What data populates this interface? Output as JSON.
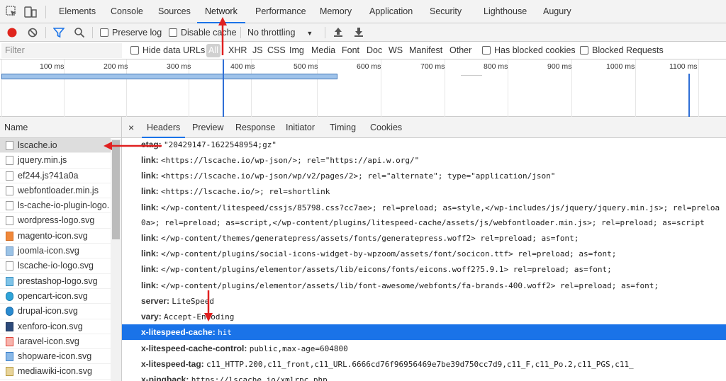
{
  "tabs": [
    "Elements",
    "Console",
    "Sources",
    "Network",
    "Performance",
    "Memory",
    "Application",
    "Security",
    "Lighthouse",
    "Augury"
  ],
  "active_tab": "Network",
  "toolbar": {
    "preserve_log": "Preserve log",
    "disable_cache": "Disable cache",
    "throttling": "No throttling"
  },
  "filter": {
    "placeholder": "Filter",
    "hide_data_urls": "Hide data URLs",
    "types": [
      "All",
      "XHR",
      "JS",
      "CSS",
      "Img",
      "Media",
      "Font",
      "Doc",
      "WS",
      "Manifest",
      "Other"
    ],
    "has_blocked_cookies": "Has blocked cookies",
    "blocked_requests": "Blocked Requests"
  },
  "timeline": {
    "ticks": [
      "100 ms",
      "200 ms",
      "300 ms",
      "400 ms",
      "500 ms",
      "600 ms",
      "700 ms",
      "800 ms",
      "900 ms",
      "1000 ms",
      "1100 ms"
    ]
  },
  "name_column": {
    "header": "Name",
    "files": [
      "lscache.io",
      "jquery.min.js",
      "ef244.js?41a0a",
      "webfontloader.min.js",
      "ls-cache-io-plugin-logo.",
      "wordpress-logo.svg",
      "magento-icon.svg",
      "joomla-icon.svg",
      "lscache-io-logo.svg",
      "prestashop-logo.svg",
      "opencart-icon.svg",
      "drupal-icon.svg",
      "xenforo-icon.svg",
      "laravel-icon.svg",
      "shopware-icon.svg",
      "mediawiki-icon.svg"
    ]
  },
  "detail_tabs": [
    "×",
    "Headers",
    "Preview",
    "Response",
    "Initiator",
    "Timing",
    "Cookies"
  ],
  "headers": [
    {
      "k": "etag:",
      "v": "\"20429147-1622548954;gz\""
    },
    {
      "k": "link:",
      "v": "<https://lscache.io/wp-json/>; rel=\"https://api.w.org/\""
    },
    {
      "k": "link:",
      "v": "<https://lscache.io/wp-json/wp/v2/pages/2>; rel=\"alternate\"; type=\"application/json\""
    },
    {
      "k": "link:",
      "v": "<https://lscache.io/>; rel=shortlink"
    },
    {
      "k": "link:",
      "v": "</wp-content/litespeed/cssjs/85798.css?cc7ae>; rel=preload; as=style,</wp-includes/js/jquery/jquery.min.js>; rel=preloa"
    },
    {
      "k": "",
      "v": "0a>; rel=preload; as=script,</wp-content/plugins/litespeed-cache/assets/js/webfontloader.min.js>; rel=preload; as=script"
    },
    {
      "k": "link:",
      "v": "</wp-content/themes/generatepress/assets/fonts/generatepress.woff2> rel=preload; as=font;"
    },
    {
      "k": "link:",
      "v": "</wp-content/plugins/social-icons-widget-by-wpzoom/assets/font/socicon.ttf> rel=preload; as=font;"
    },
    {
      "k": "link:",
      "v": "</wp-content/plugins/elementor/assets/lib/eicons/fonts/eicons.woff2?5.9.1> rel=preload; as=font;"
    },
    {
      "k": "link:",
      "v": "</wp-content/plugins/elementor/assets/lib/font-awesome/webfonts/fa-brands-400.woff2> rel=preload; as=font;"
    },
    {
      "k": "server:",
      "v": "LiteSpeed"
    },
    {
      "k": "vary:",
      "v": "Accept-Encoding"
    },
    {
      "k": "x-litespeed-cache:",
      "v": "hit"
    },
    {
      "k": "x-litespeed-cache-control:",
      "v": "public,max-age=604800"
    },
    {
      "k": "x-litespeed-tag:",
      "v": "c11_HTTP.200,c11_front,c11_URL.6666cd76f96956469e7be39d750cc7d9,c11_F,c11_Po.2,c11_PGS,c11_"
    },
    {
      "k": "x-pingback:",
      "v": "https://lscache.io/xmlrpc.php"
    }
  ],
  "selected_header": "x-litespeed-cache:",
  "colors": {
    "accent": "#1a73e8",
    "annotation": "#e02020",
    "record": "#e0251d"
  }
}
